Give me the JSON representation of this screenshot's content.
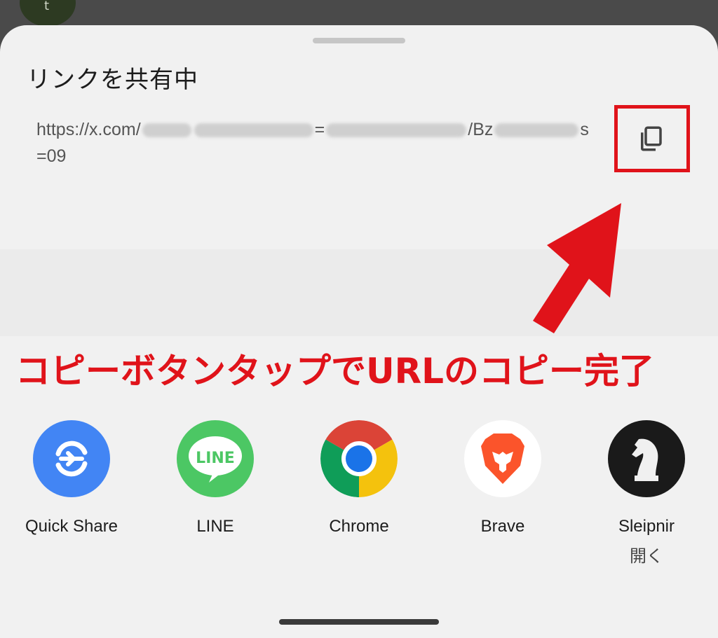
{
  "header": {
    "avatar_letter": "t"
  },
  "sheet": {
    "title": "リンクを共有中",
    "url_visible_start": "https://x.com/",
    "url_visible_mid1": "=",
    "url_visible_mid2": "/Bz",
    "url_visible_end": "s",
    "url_line2": "=09"
  },
  "annotation": {
    "caption": "コピーボタンタップでURLのコピー完了",
    "color": "#e0131a"
  },
  "share_targets": [
    {
      "label": "Quick Share",
      "sub": "",
      "icon": "quick-share-icon",
      "color": "#4285f4"
    },
    {
      "label": "LINE",
      "sub": "",
      "icon": "line-icon",
      "color": "#4cc764"
    },
    {
      "label": "Chrome",
      "sub": "",
      "icon": "chrome-icon",
      "color": "#db4437"
    },
    {
      "label": "Brave",
      "sub": "",
      "icon": "brave-icon",
      "color": "#fb542b"
    },
    {
      "label": "Sleipnir",
      "sub": "開く",
      "icon": "sleipnir-icon",
      "color": "#1a1a1a"
    }
  ]
}
